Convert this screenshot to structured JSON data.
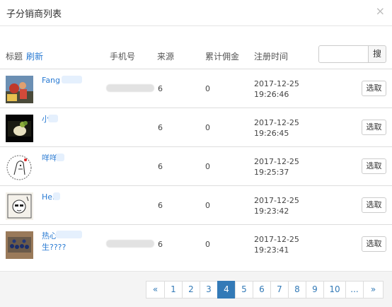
{
  "dialog": {
    "title": "子分销商列表",
    "close_icon": "×"
  },
  "table": {
    "headers": {
      "title": "标题",
      "refresh": "刷新",
      "phone": "手机号",
      "source": "来源",
      "commission": "累计佣金",
      "register_time": "注册时间"
    },
    "search_button": "搜",
    "select_label": "选取",
    "rows": [
      {
        "name": "Fang",
        "source": "6",
        "commission": "0",
        "date": "2017-12-25",
        "time": "19:26:46"
      },
      {
        "name": "小",
        "source": "6",
        "commission": "0",
        "date": "2017-12-25",
        "time": "19:26:45"
      },
      {
        "name": "咩咩",
        "source": "6",
        "commission": "0",
        "date": "2017-12-25",
        "time": "19:25:37"
      },
      {
        "name": "Her",
        "source": "6",
        "commission": "0",
        "date": "2017-12-25",
        "time": "19:23:42"
      },
      {
        "name": "热心",
        "name_line2": "生????",
        "source": "6",
        "commission": "0",
        "date": "2017-12-25",
        "time": "19:23:41"
      }
    ]
  },
  "pagination": {
    "prev": "«",
    "pages": [
      "1",
      "2",
      "3",
      "4",
      "5",
      "6",
      "7",
      "8",
      "9",
      "10"
    ],
    "current": "4",
    "ellipsis": "...",
    "next": "»"
  }
}
